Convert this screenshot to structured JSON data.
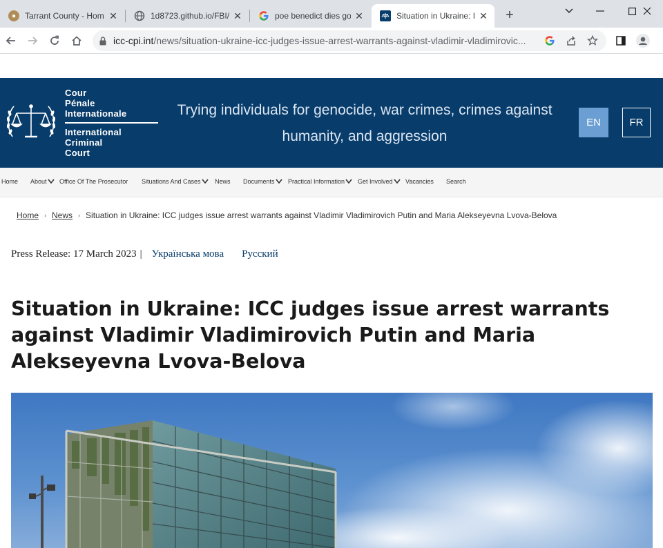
{
  "browser": {
    "tabs": [
      {
        "title": "Tarrant County - Hom",
        "favicon": "seal-icon"
      },
      {
        "title": "1d8723.github.io/FBI/",
        "favicon": "globe-icon"
      },
      {
        "title": "poe benedict dies go",
        "favicon": "google-icon"
      },
      {
        "title": "Situation in Ukraine: I",
        "favicon": "icc-icon"
      }
    ],
    "active_tab_index": 3,
    "url_host": "icc-cpi.int",
    "url_path": "/news/situation-ukraine-icc-judges-issue-arrest-warrants-against-vladimir-vladimirovic..."
  },
  "header": {
    "brand_fr": [
      "Cour",
      "Pénale",
      "Internationale"
    ],
    "brand_en": [
      "International",
      "Criminal",
      "Court"
    ],
    "tagline": "Trying individuals for genocide, war crimes, crimes against humanity, and aggression",
    "lang_en": "EN",
    "lang_fr": "FR",
    "colors": {
      "primary": "#083c6b",
      "active_lang": "#6b9fd3"
    }
  },
  "nav": {
    "items": [
      {
        "label": "Home"
      },
      {
        "label": "About"
      },
      {
        "label": "Office Of The Prosecutor"
      },
      {
        "label": "Situations And Cases"
      },
      {
        "label": "News"
      },
      {
        "label": "Documents"
      },
      {
        "label": "Practical Information"
      },
      {
        "label": "Get Involved"
      },
      {
        "label": "Vacancies"
      },
      {
        "label": "Search"
      }
    ]
  },
  "breadcrumb": {
    "home": "Home",
    "news": "News",
    "current": "Situation in Ukraine: ICC judges issue arrest warrants against Vladimir Vladimirovich Putin and Maria Alekseyevna Lvova-Belova"
  },
  "article": {
    "press_release": "Press Release: 17 March 2023",
    "pipe": "|",
    "lang_ukrainian": "Українська мова",
    "lang_russian": "Русский",
    "headline": "Situation in Ukraine: ICC judges issue arrest warrants against Vladimir Vladimirovich Putin and Maria Alekseyevna Lvova-Belova"
  }
}
